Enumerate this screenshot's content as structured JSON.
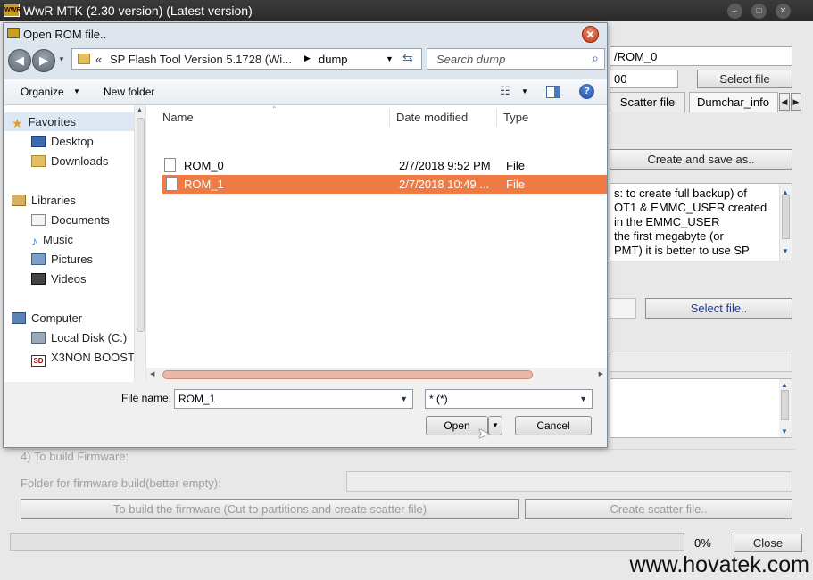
{
  "main_window": {
    "logo_text": "WWR",
    "title": "WwR MTK (2.30 version) (Latest version)",
    "rom_path": "/ROM_0",
    "size_value": "00",
    "select_file_label": "Select file",
    "tabs": [
      "Scatter file",
      "Dumchar_info"
    ],
    "create_save_label": "Create and save as..",
    "info_text": [
      "s: to create full backup) of",
      "OT1 & EMMC_USER created",
      "in the EMMC_USER",
      "the first megabyte (or",
      "PMT) it is better to use SP"
    ],
    "select_file2_label": "Select file..",
    "firmware_section": "4) To build Firmware:",
    "firmware_folder_label": "Folder for firmware build(better empty):",
    "build_firmware_label": "To build the firmware (Cut to partitions and create scatter file)",
    "create_scatter_label": "Create scatter file..",
    "progress_text": "0%",
    "progress_value": 0,
    "close_label": "Close"
  },
  "dialog": {
    "title": "Open ROM file..",
    "close_symbol": "✕",
    "breadcrumb_prefix": "«",
    "breadcrumb": [
      "SP Flash Tool Version 5.1728 (Wi...",
      "dump"
    ],
    "search_placeholder": "Search dump",
    "organize_label": "Organize",
    "new_folder_label": "New folder",
    "sidebar": {
      "favorites": "Favorites",
      "fav_items": [
        "Desktop",
        "Downloads"
      ],
      "libraries": "Libraries",
      "lib_items": [
        "Documents",
        "Music",
        "Pictures",
        "Videos"
      ],
      "computer": "Computer",
      "comp_items": [
        "Local Disk (C:)",
        "X3NON BOOST"
      ]
    },
    "columns": [
      "Name",
      "Date modified",
      "Type"
    ],
    "files": [
      {
        "name": "ROM_0",
        "date": "2/7/2018 9:52 PM",
        "type": "File"
      },
      {
        "name": "ROM_1",
        "date": "2/7/2018 10:49 ...",
        "type": "File"
      }
    ],
    "file_name_label": "File name:",
    "file_name_value": "ROM_1",
    "filter_value": "* (*)",
    "open_label": "Open",
    "cancel_label": "Cancel"
  },
  "watermark": "www.hovatek.com"
}
